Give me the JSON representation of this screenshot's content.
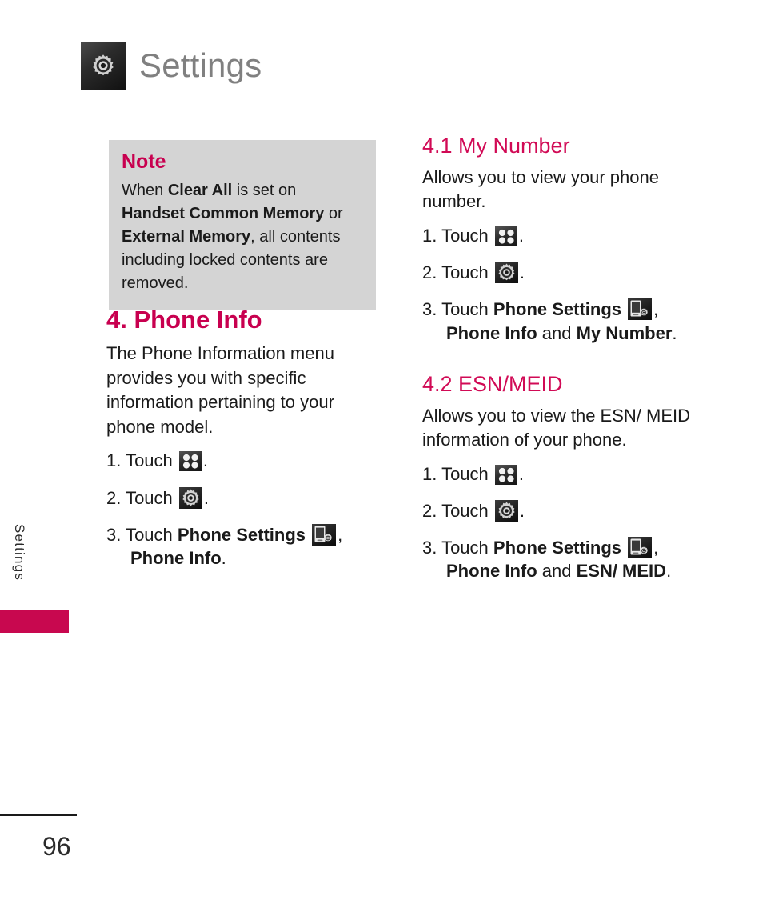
{
  "header": {
    "title": "Settings",
    "icon": "gear-icon"
  },
  "side_tab": {
    "label": "Settings",
    "bar_color": "#c8084f"
  },
  "colors": {
    "accent_pink": "#c8004f",
    "heading_pink": "#d10a55",
    "note_background": "#d4d4d4",
    "header_title": "#808080",
    "body_text": "#1a1a1a"
  },
  "note": {
    "title": "Note",
    "text_parts": [
      {
        "t": "When ",
        "bold": false
      },
      {
        "t": "Clear All",
        "bold": true
      },
      {
        "t": " is set on ",
        "bold": false
      },
      {
        "t": "Handset Common Memory",
        "bold": true
      },
      {
        "t": " or ",
        "bold": false
      },
      {
        "t": "External Memory",
        "bold": true
      },
      {
        "t": ", all contents including locked contents are removed.",
        "bold": false
      }
    ],
    "plain_text": "When Clear All is set on Handset Common Memory or External Memory, all contents including locked contents are removed."
  },
  "sections": [
    {
      "id": "phone-info",
      "column": "left",
      "heading": "4. Phone Info",
      "heading_level": 1,
      "paragraph": "The Phone Information menu provides you with specific information pertaining to your phone model.",
      "steps": [
        {
          "number": "1.",
          "parts": [
            {
              "t": "Touch ",
              "bold": false
            },
            {
              "icon": "grid-menu-icon"
            },
            {
              "t": ".",
              "bold": false
            }
          ]
        },
        {
          "number": "2.",
          "parts": [
            {
              "t": "Touch ",
              "bold": false
            },
            {
              "icon": "gear-settings-icon"
            },
            {
              "t": ".",
              "bold": false
            }
          ]
        },
        {
          "number": "3.",
          "parts": [
            {
              "t": "Touch ",
              "bold": false
            },
            {
              "t": "Phone Settings",
              "bold": true
            },
            {
              "t": " ",
              "bold": false
            },
            {
              "icon": "phone-settings-icon"
            },
            {
              "t": ",",
              "bold": false
            },
            {
              "br": true
            },
            {
              "t": "Phone Info",
              "bold": true
            },
            {
              "t": ".",
              "bold": false
            }
          ]
        }
      ]
    },
    {
      "id": "my-number",
      "column": "right",
      "heading": "4.1 My Number",
      "heading_level": 2,
      "paragraph": "Allows you to view your phone number.",
      "steps": [
        {
          "number": "1.",
          "parts": [
            {
              "t": "Touch ",
              "bold": false
            },
            {
              "icon": "grid-menu-icon"
            },
            {
              "t": ".",
              "bold": false
            }
          ]
        },
        {
          "number": "2.",
          "parts": [
            {
              "t": "Touch ",
              "bold": false
            },
            {
              "icon": "gear-settings-icon"
            },
            {
              "t": ".",
              "bold": false
            }
          ]
        },
        {
          "number": "3.",
          "parts": [
            {
              "t": "Touch ",
              "bold": false
            },
            {
              "t": "Phone Settings",
              "bold": true
            },
            {
              "t": " ",
              "bold": false
            },
            {
              "icon": "phone-settings-icon"
            },
            {
              "t": ",",
              "bold": false
            },
            {
              "br": true
            },
            {
              "t": "Phone Info",
              "bold": true
            },
            {
              "t": " and ",
              "bold": false
            },
            {
              "t": "My Number",
              "bold": true
            },
            {
              "t": ".",
              "bold": false
            }
          ]
        }
      ]
    },
    {
      "id": "esn-meid",
      "column": "right",
      "heading": "4.2 ESN/MEID",
      "heading_level": 2,
      "paragraph": "Allows you to view the ESN/ MEID information of your phone.",
      "steps": [
        {
          "number": "1.",
          "parts": [
            {
              "t": "Touch ",
              "bold": false
            },
            {
              "icon": "grid-menu-icon"
            },
            {
              "t": ".",
              "bold": false
            }
          ]
        },
        {
          "number": "2.",
          "parts": [
            {
              "t": "Touch ",
              "bold": false
            },
            {
              "icon": "gear-settings-icon"
            },
            {
              "t": ".",
              "bold": false
            }
          ]
        },
        {
          "number": "3.",
          "parts": [
            {
              "t": "Touch ",
              "bold": false
            },
            {
              "t": "Phone Settings",
              "bold": true
            },
            {
              "t": " ",
              "bold": false
            },
            {
              "icon": "phone-settings-icon"
            },
            {
              "t": ",",
              "bold": false
            },
            {
              "br": true
            },
            {
              "t": "Phone Info",
              "bold": true
            },
            {
              "t": " and ",
              "bold": false
            },
            {
              "t": "ESN/ MEID",
              "bold": true
            },
            {
              "t": ".",
              "bold": false
            }
          ]
        }
      ]
    }
  ],
  "footer": {
    "page_number": "96"
  }
}
